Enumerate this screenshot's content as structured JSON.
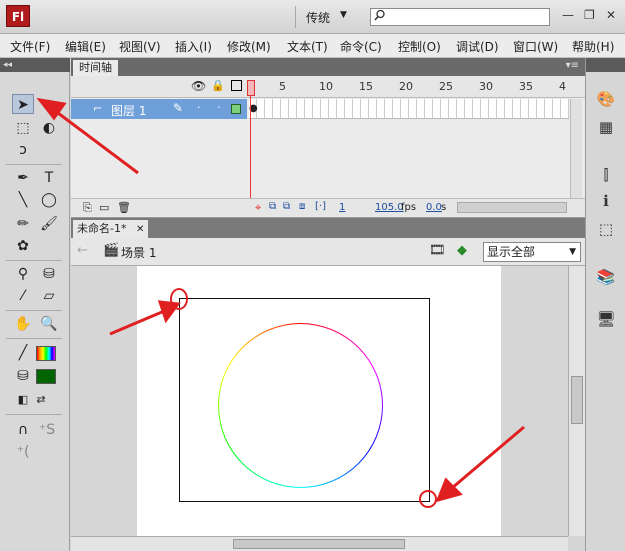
{
  "title_bar": {
    "logo": "Fl",
    "workspace": "传统",
    "workspace_arrow": "▼",
    "search_icon": "search-icon",
    "min": "—",
    "restore": "❐",
    "close": "✕"
  },
  "menu": [
    "文件(F)",
    "编辑(E)",
    "视图(V)",
    "插入(I)",
    "修改(M)",
    "文本(T)",
    "命令(C)",
    "控制(O)",
    "调试(D)",
    "窗口(W)",
    "帮助(H)"
  ],
  "timeline": {
    "tab": "时间轴",
    "layer_name": "图层 1",
    "frame_numbers": [
      "1",
      "5",
      "10",
      "15",
      "20",
      "25",
      "30",
      "35",
      "4"
    ],
    "footer": {
      "frame": "1",
      "fps": "105.0",
      "fps_unit": "fps",
      "time": "0.0",
      "time_unit": "s"
    }
  },
  "document": {
    "tab": "未命名-1*",
    "tab_close": "✕",
    "scene": "场景 1",
    "zoom": "显示全部"
  },
  "colors": {
    "stroke_swatch": "rainbow-gradient",
    "fill_swatch": "#006400",
    "annotation": "#e02020"
  }
}
